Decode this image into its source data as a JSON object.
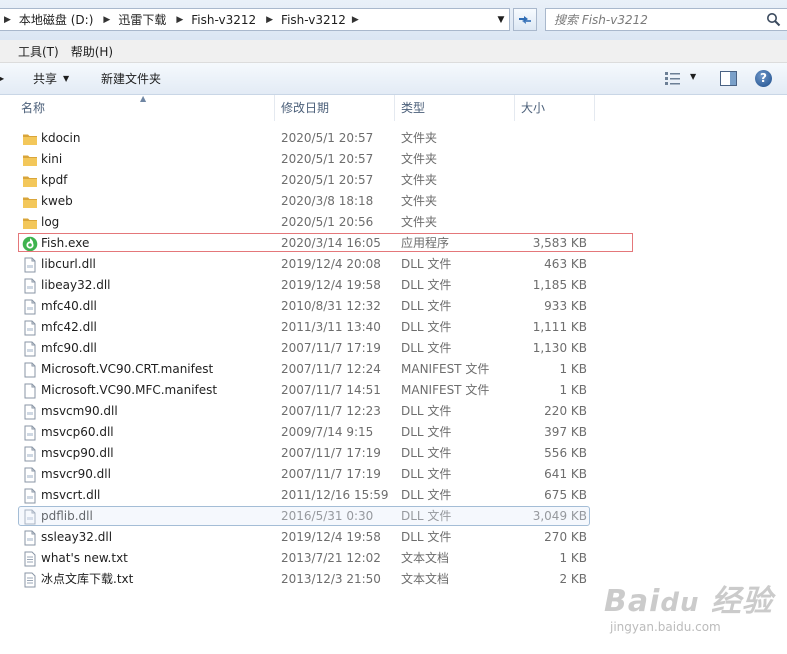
{
  "address": {
    "crumbs": [
      "本地磁盘 (D:)",
      "迅雷下载",
      "Fish-v3212",
      "Fish-v3212"
    ]
  },
  "search": {
    "placeholder": "搜索 Fish-v3212"
  },
  "menu": {
    "items": [
      "工具(T)",
      "帮助(H)"
    ]
  },
  "commands": {
    "share": "共享",
    "new_folder": "新建文件夹"
  },
  "columns": {
    "name": "名称",
    "date": "修改日期",
    "type": "类型",
    "size": "大小"
  },
  "colors": {
    "folder": "#e8b849",
    "selection_red": "#e4777a",
    "selection_blue": "#a4bdd6",
    "exe_green": "#3fb34f"
  },
  "files": [
    {
      "name": "kdocin",
      "date": "2020/5/1 20:57",
      "type": "文件夹",
      "size": "",
      "icon": "folder-icon"
    },
    {
      "name": "kini",
      "date": "2020/5/1 20:57",
      "type": "文件夹",
      "size": "",
      "icon": "folder-icon"
    },
    {
      "name": "kpdf",
      "date": "2020/5/1 20:57",
      "type": "文件夹",
      "size": "",
      "icon": "folder-icon"
    },
    {
      "name": "kweb",
      "date": "2020/3/8 18:18",
      "type": "文件夹",
      "size": "",
      "icon": "folder-icon"
    },
    {
      "name": "log",
      "date": "2020/5/1 20:56",
      "type": "文件夹",
      "size": "",
      "icon": "folder-icon"
    },
    {
      "name": "Fish.exe",
      "date": "2020/3/14 16:05",
      "type": "应用程序",
      "size": "3,583 KB",
      "icon": "fish-app-icon"
    },
    {
      "name": "libcurl.dll",
      "date": "2019/12/4 20:08",
      "type": "DLL 文件",
      "size": "463 KB",
      "icon": "dll-file-icon"
    },
    {
      "name": "libeay32.dll",
      "date": "2019/12/4 19:58",
      "type": "DLL 文件",
      "size": "1,185 KB",
      "icon": "dll-file-icon"
    },
    {
      "name": "mfc40.dll",
      "date": "2010/8/31 12:32",
      "type": "DLL 文件",
      "size": "933 KB",
      "icon": "dll-file-icon"
    },
    {
      "name": "mfc42.dll",
      "date": "2011/3/11 13:40",
      "type": "DLL 文件",
      "size": "1,111 KB",
      "icon": "dll-file-icon"
    },
    {
      "name": "mfc90.dll",
      "date": "2007/11/7 17:19",
      "type": "DLL 文件",
      "size": "1,130 KB",
      "icon": "dll-file-icon"
    },
    {
      "name": "Microsoft.VC90.CRT.manifest",
      "date": "2007/11/7 12:24",
      "type": "MANIFEST 文件",
      "size": "1 KB",
      "icon": "blank-file-icon"
    },
    {
      "name": "Microsoft.VC90.MFC.manifest",
      "date": "2007/11/7 14:51",
      "type": "MANIFEST 文件",
      "size": "1 KB",
      "icon": "blank-file-icon"
    },
    {
      "name": "msvcm90.dll",
      "date": "2007/11/7 12:23",
      "type": "DLL 文件",
      "size": "220 KB",
      "icon": "dll-file-icon"
    },
    {
      "name": "msvcp60.dll",
      "date": "2009/7/14 9:15",
      "type": "DLL 文件",
      "size": "397 KB",
      "icon": "dll-file-icon"
    },
    {
      "name": "msvcp90.dll",
      "date": "2007/11/7 17:19",
      "type": "DLL 文件",
      "size": "556 KB",
      "icon": "dll-file-icon"
    },
    {
      "name": "msvcr90.dll",
      "date": "2007/11/7 17:19",
      "type": "DLL 文件",
      "size": "641 KB",
      "icon": "dll-file-icon"
    },
    {
      "name": "msvcrt.dll",
      "date": "2011/12/16 15:59",
      "type": "DLL 文件",
      "size": "675 KB",
      "icon": "dll-file-icon"
    },
    {
      "name": "pdflib.dll",
      "date": "2016/5/31 0:30",
      "type": "DLL 文件",
      "size": "3,049 KB",
      "icon": "dll-file-icon"
    },
    {
      "name": "ssleay32.dll",
      "date": "2019/12/4 19:58",
      "type": "DLL 文件",
      "size": "270 KB",
      "icon": "dll-file-icon"
    },
    {
      "name": "what's new.txt",
      "date": "2013/7/21 12:02",
      "type": "文本文档",
      "size": "1 KB",
      "icon": "text-file-icon"
    },
    {
      "name": "冰点文库下载.txt",
      "date": "2013/12/3 21:50",
      "type": "文本文档",
      "size": "2 KB",
      "icon": "text-file-icon"
    }
  ],
  "watermark": {
    "url": "jingyan.baidu.com"
  }
}
